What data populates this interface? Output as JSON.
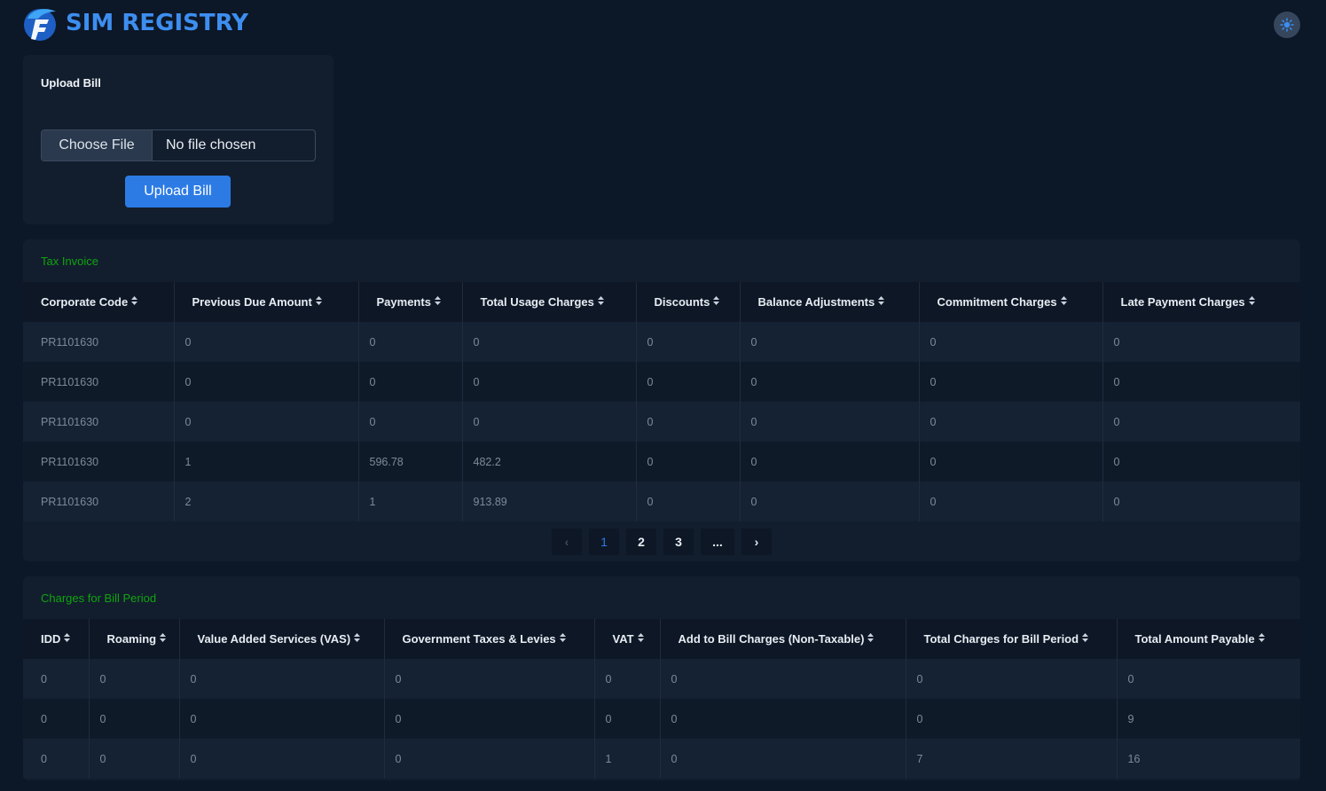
{
  "header": {
    "brand": "SIM REGISTRY",
    "logo_icon": "f-logo-icon",
    "theme_icon": "sun-icon"
  },
  "upload": {
    "title": "Upload Bill",
    "choose_label": "Choose File",
    "file_status": "No file chosen",
    "button_label": "Upload Bill"
  },
  "tax_invoice": {
    "title": "Tax Invoice",
    "columns": [
      "Corporate Code",
      "Previous Due Amount",
      "Payments",
      "Total Usage Charges",
      "Discounts",
      "Balance Adjustments",
      "Commitment Charges",
      "Late Payment Charges"
    ],
    "rows": [
      [
        "PR1101630",
        "0",
        "0",
        "0",
        "0",
        "0",
        "0",
        "0"
      ],
      [
        "PR1101630",
        "0",
        "0",
        "0",
        "0",
        "0",
        "0",
        "0"
      ],
      [
        "PR1101630",
        "0",
        "0",
        "0",
        "0",
        "0",
        "0",
        "0"
      ],
      [
        "PR1101630",
        "1",
        "596.78",
        "482.2",
        "0",
        "0",
        "0",
        "0"
      ],
      [
        "PR1101630",
        "2",
        "1",
        "913.89",
        "0",
        "0",
        "0",
        "0"
      ]
    ],
    "pagination": {
      "prev": "‹",
      "pages": [
        "1",
        "2",
        "3"
      ],
      "ellipsis": "...",
      "next": "›",
      "current": "1"
    }
  },
  "charges": {
    "title": "Charges for Bill Period",
    "columns": [
      "IDD",
      "Roaming",
      "Value Added Services (VAS)",
      "Government Taxes & Levies",
      "VAT",
      "Add to Bill Charges (Non-Taxable)",
      "Total Charges for Bill Period",
      "Total Amount Payable"
    ],
    "rows": [
      [
        "0",
        "0",
        "0",
        "0",
        "0",
        "0",
        "0",
        "0"
      ],
      [
        "0",
        "0",
        "0",
        "0",
        "0",
        "0",
        "0",
        "9"
      ],
      [
        "0",
        "0",
        "0",
        "0",
        "1",
        "0",
        "7",
        "16"
      ]
    ]
  },
  "colors": {
    "background": "#0c1727",
    "card": "#121e2d",
    "accent": "#2c7be5",
    "section_title": "#10a310"
  }
}
